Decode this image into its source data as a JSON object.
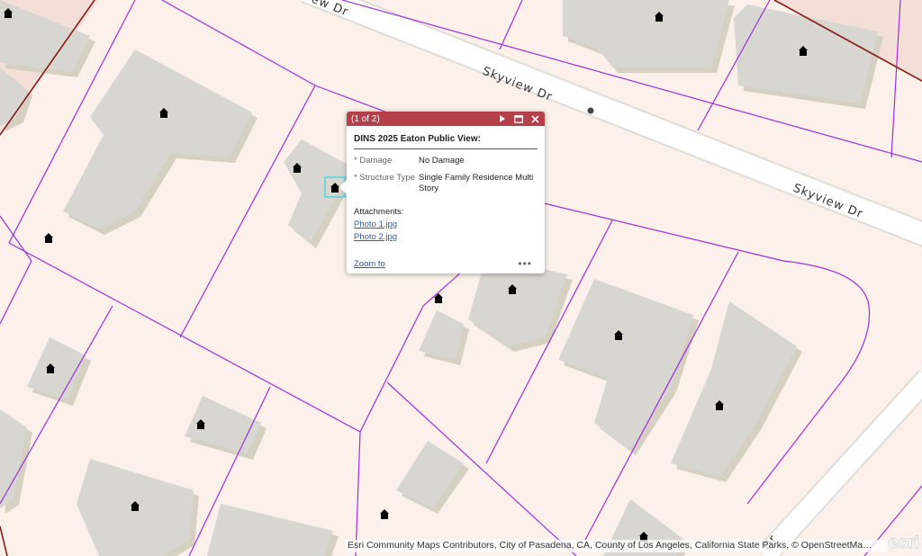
{
  "map": {
    "road_labels": [
      "Skyview Dr",
      "Skyview Dr",
      "Dr"
    ],
    "colors": {
      "background": "#fbf1ea",
      "building": "#d8d6d1",
      "building_shadow": "#d6d0c3",
      "parcel_line": "#9b2fe0",
      "boundary_line": "#8c1a14",
      "road": "#ffffff",
      "house_icon": "#000000"
    },
    "icons": [
      "house-icon",
      "location-dot-icon"
    ]
  },
  "popup": {
    "count": "(1 of 2)",
    "title": "DINS 2025 Eaton Public View:",
    "fields": [
      {
        "label": "* Damage",
        "value": "No Damage"
      },
      {
        "label": "* Structure Type",
        "value": "Single Family Residence Multi Story"
      }
    ],
    "attachments_label": "Attachments:",
    "attachments": [
      "Photo 1.jpg",
      "Photo 2.jpg"
    ],
    "zoom_label": "Zoom to",
    "more_label": "•••",
    "header_color": "#b4414a"
  },
  "attribution": "Esri Community Maps Contributors, City of Pasadena, CA, County of Los Angeles, California State Parks, © OpenStreetMa…",
  "logo_text": "esri",
  "logo_caption": "POWERED BY"
}
